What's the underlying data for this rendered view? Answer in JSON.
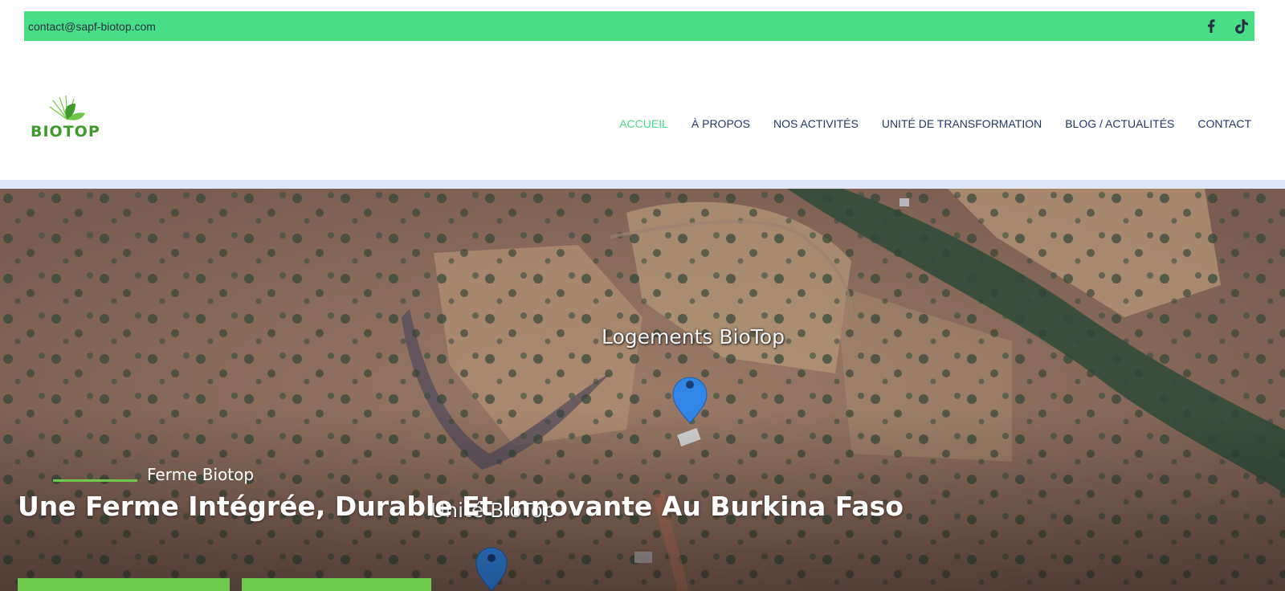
{
  "topbar": {
    "email": "contact@sapf-biotop.com",
    "social": [
      {
        "icon": "facebook-icon"
      },
      {
        "icon": "tiktok-icon"
      }
    ],
    "bg_color": "#48de86"
  },
  "logo": {
    "text": "BIOTOP",
    "color": "#3f9b2c"
  },
  "nav": {
    "items": [
      {
        "label": "ACCUEIL",
        "active": true
      },
      {
        "label": "À PROPOS",
        "active": false
      },
      {
        "label": "NOS ACTIVITÉS",
        "active": false
      },
      {
        "label": "UNITÉ DE TRANSFORMATION",
        "active": false
      },
      {
        "label": "BLOG / ACTUALITÉS",
        "active": false
      },
      {
        "label": "CONTACT",
        "active": false
      }
    ],
    "active_color": "#48de86",
    "color": "#25376a"
  },
  "hero": {
    "map_labels": [
      "Logements BioTop",
      "Unité BioTop"
    ],
    "subtitle": "Ferme Biotop",
    "title": "Une Ferme Intégrée, Durable Et Innovante Au Burkina Faso",
    "button_color": "#6ec84a"
  }
}
